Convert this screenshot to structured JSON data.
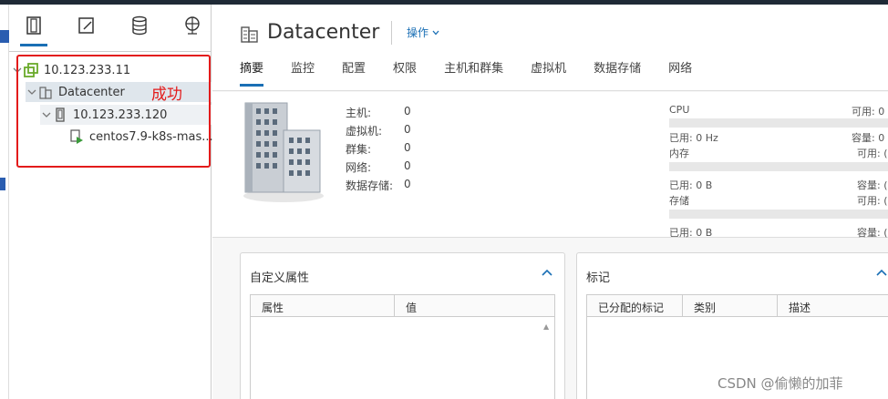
{
  "nav": {
    "tabs": [
      {
        "name": "hosts-clusters-icon"
      },
      {
        "name": "vms-templates-icon"
      },
      {
        "name": "storage-icon"
      },
      {
        "name": "network-icon"
      }
    ],
    "tree": [
      {
        "label": "10.123.233.11"
      },
      {
        "label": "Datacenter"
      },
      {
        "label": "10.123.233.120"
      },
      {
        "label": "centos7.9-k8s-mas..."
      }
    ],
    "annotation": "成功"
  },
  "header": {
    "title": "Datacenter",
    "actions_label": "操作",
    "tabs": [
      "摘要",
      "监控",
      "配置",
      "权限",
      "主机和群集",
      "虚拟机",
      "数据存储",
      "网络"
    ]
  },
  "summary": {
    "counts": [
      {
        "label": "主机:",
        "value": "0"
      },
      {
        "label": "虚拟机:",
        "value": "0"
      },
      {
        "label": "群集:",
        "value": "0"
      },
      {
        "label": "网络:",
        "value": "0"
      },
      {
        "label": "数据存储:",
        "value": "0"
      }
    ],
    "resources": [
      {
        "name": "CPU",
        "free": "可用: 0",
        "used": "已用: 0 Hz",
        "capacity": "容量: 0"
      },
      {
        "name": "内存",
        "free": "可用: (",
        "used": "已用: 0 B",
        "capacity": "容量: ("
      },
      {
        "name": "存储",
        "free": "可用: (",
        "used": "已用: 0 B",
        "capacity": "容量: ("
      }
    ]
  },
  "custom_attributes": {
    "title": "自定义属性",
    "columns": [
      "属性",
      "值"
    ]
  },
  "tags": {
    "title": "标记",
    "columns": [
      "已分配的标记",
      "类别",
      "描述"
    ]
  },
  "watermark": "CSDN @偷懒的加菲",
  "colors": {
    "accent": "#1a6fb5",
    "highlight": "#e31b1b",
    "selected": "#dfe6ec"
  }
}
